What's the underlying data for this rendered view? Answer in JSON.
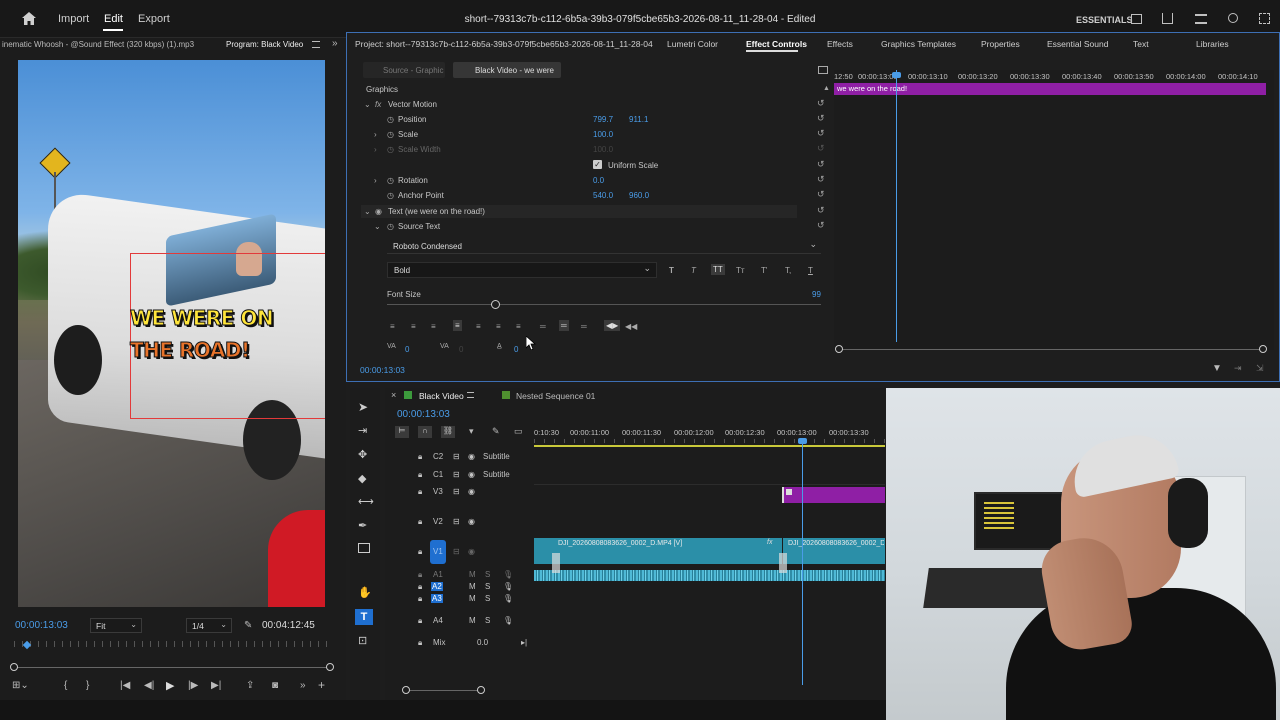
{
  "header": {
    "import": "Import",
    "edit": "Edit",
    "export": "Export",
    "title": "short--79313c7b-c112-6b5a-39b3-079f5cbe65b3-2026-08-11_11-28-04 - Edited",
    "workspace": "ESSENTIALS"
  },
  "source_panel": {
    "tab_source": "inematic Whoosh - @Sound Effect (320 kbps) (1).mp3",
    "tab_program": "Program: Black Video",
    "timecode": "00:00:13:03",
    "fit": "Fit",
    "quality": "1/4",
    "duration": "00:04:12:45",
    "caption_line1": "WE WERE ON",
    "caption_line2": "THE ROAD!"
  },
  "effects_panel": {
    "tabs": [
      "Project: short--79313c7b-c112-6b5a-39b3-079f5cbe65b3-2026-08-11_11-28-04",
      "Lumetri Color",
      "Effect Controls",
      "Effects",
      "Graphics Templates",
      "Properties",
      "Essential Sound",
      "Text",
      "Libraries"
    ],
    "active_tab": "Effect Controls",
    "source_tab": "Source - Graphic",
    "clip_tab": "Black Video - we were",
    "section": "Graphics",
    "vector_motion": "Vector Motion",
    "position_label": "Position",
    "position_x": "799.7",
    "position_y": "911.1",
    "scale_label": "Scale",
    "scale_value": "100.0",
    "scale_width_label": "Scale Width",
    "scale_width_value": "100.0",
    "uniform_scale": "Uniform Scale",
    "rotation_label": "Rotation",
    "rotation_value": "0.0",
    "anchor_label": "Anchor Point",
    "anchor_x": "540.0",
    "anchor_y": "960.0",
    "text_layer": "Text (we were on the road!)",
    "source_text": "Source Text",
    "font": "Roboto Condensed",
    "style": "Bold",
    "font_size_label": "Font Size",
    "font_size": "99",
    "kerning": "0",
    "tracking": "0",
    "leading": "0",
    "timecode": "00:00:13:03",
    "mini_ruler": [
      "12:50",
      "00:00:13:00",
      "00:00:13:10",
      "00:00:13:20",
      "00:00:13:30",
      "00:00:13:40",
      "00:00:13:50",
      "00:00:14:00",
      "00:00:14:10"
    ],
    "mini_clip": "we were on the road!"
  },
  "timeline": {
    "tab_active": "Black Video",
    "tab_other": "Nested Sequence 01",
    "timecode": "00:00:13:03",
    "ruler": [
      "0:10:30",
      "00:00:11:00",
      "00:00:11:30",
      "00:00:12:00",
      "00:00:12:30",
      "00:00:13:00",
      "00:00:13:30"
    ],
    "tracks": [
      "C2",
      "C1",
      "V3",
      "V2",
      "V1",
      "A1",
      "A2",
      "A3",
      "A4"
    ],
    "subtitle1": "Subtitle",
    "subtitle2": "Subtitle",
    "clip1": "DJI_20260808083626_0002_D.MP4 [V]",
    "clip2": "DJI_20260808083626_0002_D",
    "mix_label": "Mix",
    "mix_value": "0.0"
  }
}
